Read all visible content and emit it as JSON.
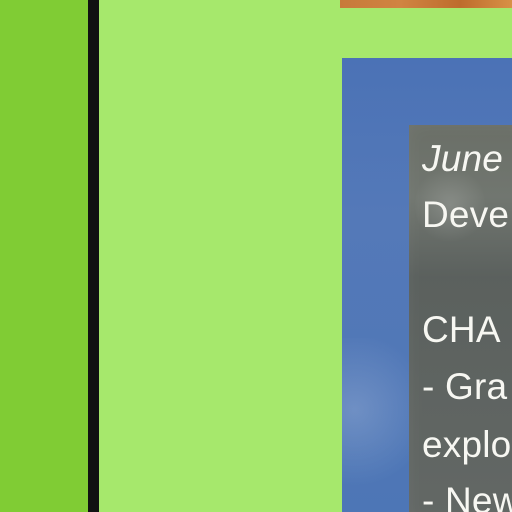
{
  "overlay_text": {
    "date": "June",
    "developer": "Deve",
    "changes_heading": "CHA",
    "bullet_1": "- Gra",
    "bullet_1_continuation": "explo",
    "bullet_2": "- New"
  },
  "colors": {
    "page_background": "#a6e86c",
    "left_rail": "#80cc34",
    "divider": "#111111",
    "card_background": "#4f76b7",
    "overlay_background": "#707060",
    "thumbnail_strip": "#c77a3a",
    "text": "#f7f7f2"
  }
}
